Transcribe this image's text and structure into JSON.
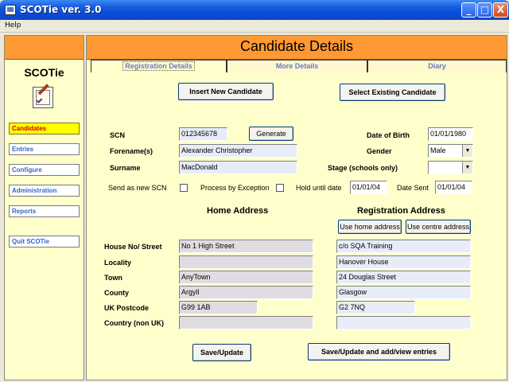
{
  "window": {
    "title": "SCOTie ver. 3.0",
    "minimize": "_",
    "maximize": "□",
    "close": "X"
  },
  "menu": {
    "help": "Help"
  },
  "sidebar": {
    "title": "SCOTie",
    "logo_icon": "checklist-pen-icon",
    "items": [
      {
        "label": "Candidates",
        "active": true
      },
      {
        "label": "Entries"
      },
      {
        "label": "Configure"
      },
      {
        "label": "Administration"
      },
      {
        "label": "Reports"
      },
      {
        "label": "Quit SCOTie"
      }
    ]
  },
  "header": {
    "title": "Candidate Details"
  },
  "tabs": [
    {
      "label": "Registration Details",
      "active": true
    },
    {
      "label": "More Details"
    },
    {
      "label": "Diary"
    }
  ],
  "actions": {
    "insert": "Insert New Candidate",
    "select": "Select Existing Candidate",
    "generate": "Generate",
    "use_home": "Use home address",
    "use_centre": "Use centre address",
    "save": "Save/Update",
    "save_entries": "Save/Update and add/view entries"
  },
  "candidate": {
    "scn_label": "SCN",
    "scn": "012345678",
    "forename_label": "Forename(s)",
    "forename": "Alexander Christopher",
    "surname_label": "Surname",
    "surname": "MacDonald",
    "dob_label": "Date of Birth",
    "dob": "01/01/1980",
    "gender_label": "Gender",
    "gender": "Male",
    "stage_label": "Stage (schools only)",
    "stage": ""
  },
  "options": {
    "send_new_scn": "Send as new SCN",
    "process_exception": "Process by Exception",
    "hold_until": "Hold until date",
    "hold_until_value": "01/01/04",
    "date_sent": "Date Sent",
    "date_sent_value": "01/01/04"
  },
  "address": {
    "home_heading": "Home Address",
    "reg_heading": "Registration Address",
    "labels": [
      "House No/ Street",
      "Locality",
      "Town",
      "County",
      "UK Postcode",
      "Country (non UK)"
    ],
    "home": [
      "No 1 High Street",
      "",
      "AnyTown",
      "Argyll",
      "G99 1AB",
      ""
    ],
    "reg": [
      "c/o SQA Training",
      "Hanover House",
      "24 Douglas Street",
      "Glasgow",
      "G2 7NQ",
      ""
    ]
  }
}
